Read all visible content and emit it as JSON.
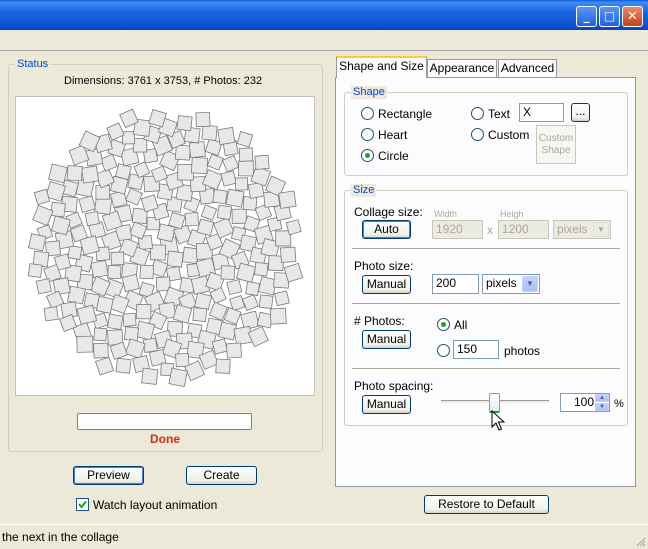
{
  "titlebar": {
    "minimize_glyph": "_",
    "maximize_glyph": "□",
    "close_glyph": "✕"
  },
  "status_group": {
    "title": "Status",
    "dimensions": "Dimensions: 3761 x 3753, # Photos: 232",
    "progress": 0,
    "done": "Done",
    "preview_label": "Preview",
    "create_label": "Create",
    "watch_label": "Watch layout animation",
    "watch_checked": true
  },
  "tabs": [
    {
      "label": "Shape and Size"
    },
    {
      "label": "Appearance"
    },
    {
      "label": "Advanced"
    }
  ],
  "shape": {
    "title": "Shape",
    "rectangle": "Rectangle",
    "heart": "Heart",
    "circle": "Circle",
    "text": "Text",
    "text_value": "X",
    "ellipsis": "...",
    "custom": "Custom",
    "custom_shape": [
      "Custom",
      "Shape"
    ],
    "selected": "Circle"
  },
  "size": {
    "title": "Size",
    "collage_size": "Collage size:",
    "auto": "Auto",
    "width_label": "Width",
    "height_label": "Heigh",
    "width_value": "1920",
    "x_sep": "x",
    "height_value": "1200",
    "unit": "pixels",
    "photo_size": "Photo size:",
    "manual": "Manual",
    "photo_size_value": "200",
    "photo_unit": "pixels",
    "photos_label": "# Photos:",
    "all": "All",
    "count_value": "150",
    "photos_word": "photos",
    "spacing_label": "Photo spacing:",
    "spacing_value": "100",
    "percent": "%",
    "slider_value": 0.5
  },
  "restore_label": "Restore to Default",
  "statusbar_text": "the next in the collage",
  "colors": {
    "title_blue": "#0a53d0",
    "group_title": "#0046d5",
    "done_red": "#d42c1c",
    "radio_on": "#21a121"
  }
}
